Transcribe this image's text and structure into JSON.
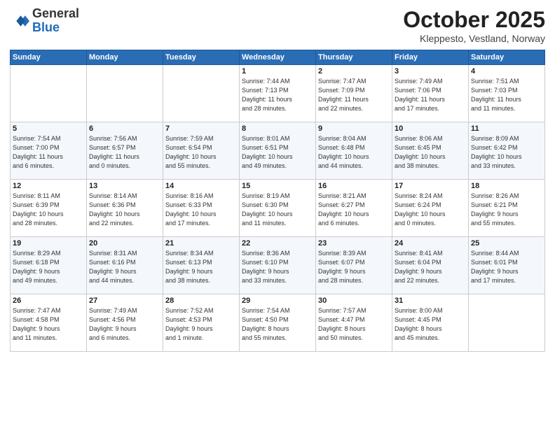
{
  "logo": {
    "general": "General",
    "blue": "Blue"
  },
  "header": {
    "month": "October 2025",
    "location": "Kleppesto, Vestland, Norway"
  },
  "days_of_week": [
    "Sunday",
    "Monday",
    "Tuesday",
    "Wednesday",
    "Thursday",
    "Friday",
    "Saturday"
  ],
  "weeks": [
    [
      {
        "day": "",
        "info": ""
      },
      {
        "day": "",
        "info": ""
      },
      {
        "day": "",
        "info": ""
      },
      {
        "day": "1",
        "info": "Sunrise: 7:44 AM\nSunset: 7:13 PM\nDaylight: 11 hours\nand 28 minutes."
      },
      {
        "day": "2",
        "info": "Sunrise: 7:47 AM\nSunset: 7:09 PM\nDaylight: 11 hours\nand 22 minutes."
      },
      {
        "day": "3",
        "info": "Sunrise: 7:49 AM\nSunset: 7:06 PM\nDaylight: 11 hours\nand 17 minutes."
      },
      {
        "day": "4",
        "info": "Sunrise: 7:51 AM\nSunset: 7:03 PM\nDaylight: 11 hours\nand 11 minutes."
      }
    ],
    [
      {
        "day": "5",
        "info": "Sunrise: 7:54 AM\nSunset: 7:00 PM\nDaylight: 11 hours\nand 6 minutes."
      },
      {
        "day": "6",
        "info": "Sunrise: 7:56 AM\nSunset: 6:57 PM\nDaylight: 11 hours\nand 0 minutes."
      },
      {
        "day": "7",
        "info": "Sunrise: 7:59 AM\nSunset: 6:54 PM\nDaylight: 10 hours\nand 55 minutes."
      },
      {
        "day": "8",
        "info": "Sunrise: 8:01 AM\nSunset: 6:51 PM\nDaylight: 10 hours\nand 49 minutes."
      },
      {
        "day": "9",
        "info": "Sunrise: 8:04 AM\nSunset: 6:48 PM\nDaylight: 10 hours\nand 44 minutes."
      },
      {
        "day": "10",
        "info": "Sunrise: 8:06 AM\nSunset: 6:45 PM\nDaylight: 10 hours\nand 38 minutes."
      },
      {
        "day": "11",
        "info": "Sunrise: 8:09 AM\nSunset: 6:42 PM\nDaylight: 10 hours\nand 33 minutes."
      }
    ],
    [
      {
        "day": "12",
        "info": "Sunrise: 8:11 AM\nSunset: 6:39 PM\nDaylight: 10 hours\nand 28 minutes."
      },
      {
        "day": "13",
        "info": "Sunrise: 8:14 AM\nSunset: 6:36 PM\nDaylight: 10 hours\nand 22 minutes."
      },
      {
        "day": "14",
        "info": "Sunrise: 8:16 AM\nSunset: 6:33 PM\nDaylight: 10 hours\nand 17 minutes."
      },
      {
        "day": "15",
        "info": "Sunrise: 8:19 AM\nSunset: 6:30 PM\nDaylight: 10 hours\nand 11 minutes."
      },
      {
        "day": "16",
        "info": "Sunrise: 8:21 AM\nSunset: 6:27 PM\nDaylight: 10 hours\nand 6 minutes."
      },
      {
        "day": "17",
        "info": "Sunrise: 8:24 AM\nSunset: 6:24 PM\nDaylight: 10 hours\nand 0 minutes."
      },
      {
        "day": "18",
        "info": "Sunrise: 8:26 AM\nSunset: 6:21 PM\nDaylight: 9 hours\nand 55 minutes."
      }
    ],
    [
      {
        "day": "19",
        "info": "Sunrise: 8:29 AM\nSunset: 6:18 PM\nDaylight: 9 hours\nand 49 minutes."
      },
      {
        "day": "20",
        "info": "Sunrise: 8:31 AM\nSunset: 6:16 PM\nDaylight: 9 hours\nand 44 minutes."
      },
      {
        "day": "21",
        "info": "Sunrise: 8:34 AM\nSunset: 6:13 PM\nDaylight: 9 hours\nand 38 minutes."
      },
      {
        "day": "22",
        "info": "Sunrise: 8:36 AM\nSunset: 6:10 PM\nDaylight: 9 hours\nand 33 minutes."
      },
      {
        "day": "23",
        "info": "Sunrise: 8:39 AM\nSunset: 6:07 PM\nDaylight: 9 hours\nand 28 minutes."
      },
      {
        "day": "24",
        "info": "Sunrise: 8:41 AM\nSunset: 6:04 PM\nDaylight: 9 hours\nand 22 minutes."
      },
      {
        "day": "25",
        "info": "Sunrise: 8:44 AM\nSunset: 6:01 PM\nDaylight: 9 hours\nand 17 minutes."
      }
    ],
    [
      {
        "day": "26",
        "info": "Sunrise: 7:47 AM\nSunset: 4:58 PM\nDaylight: 9 hours\nand 11 minutes."
      },
      {
        "day": "27",
        "info": "Sunrise: 7:49 AM\nSunset: 4:56 PM\nDaylight: 9 hours\nand 6 minutes."
      },
      {
        "day": "28",
        "info": "Sunrise: 7:52 AM\nSunset: 4:53 PM\nDaylight: 9 hours\nand 1 minute."
      },
      {
        "day": "29",
        "info": "Sunrise: 7:54 AM\nSunset: 4:50 PM\nDaylight: 8 hours\nand 55 minutes."
      },
      {
        "day": "30",
        "info": "Sunrise: 7:57 AM\nSunset: 4:47 PM\nDaylight: 8 hours\nand 50 minutes."
      },
      {
        "day": "31",
        "info": "Sunrise: 8:00 AM\nSunset: 4:45 PM\nDaylight: 8 hours\nand 45 minutes."
      },
      {
        "day": "",
        "info": ""
      }
    ]
  ]
}
